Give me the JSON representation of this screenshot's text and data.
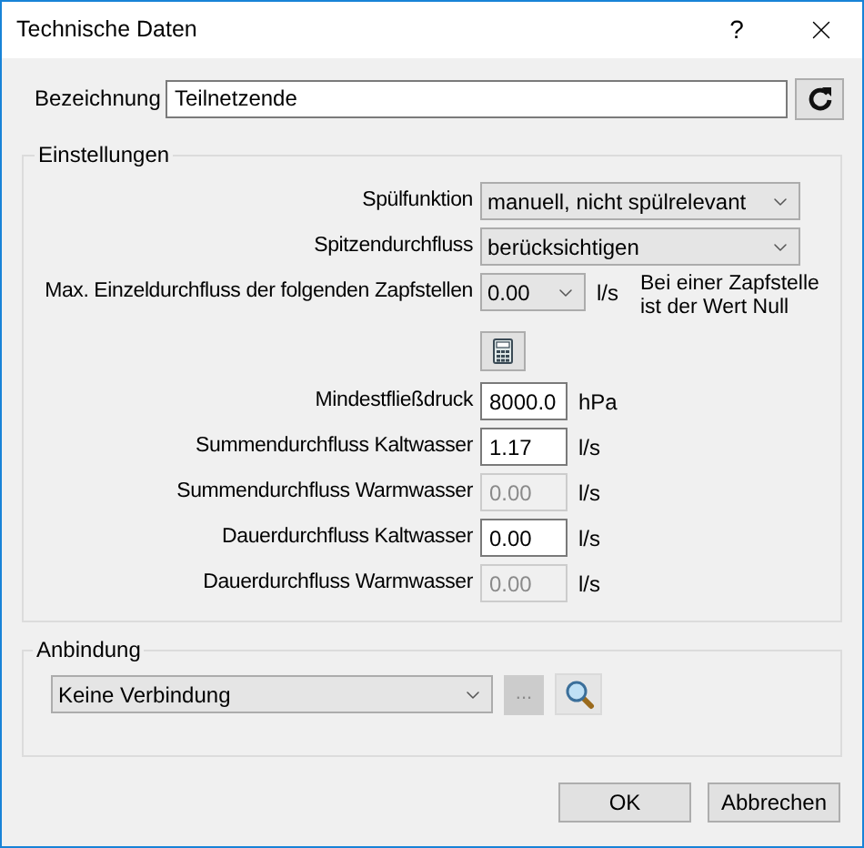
{
  "window": {
    "title": "Technische Daten",
    "help": "?"
  },
  "name_row": {
    "label": "Bezeichnung",
    "value": "Teilnetzende"
  },
  "settings": {
    "title": "Einstellungen",
    "rows": [
      {
        "kind": "select",
        "label": "Spülfunktion",
        "value": "manuell, nicht spülrelevant"
      },
      {
        "kind": "select",
        "label": "Spitzendurchfluss",
        "value": "berücksichtigen"
      },
      {
        "kind": "select",
        "label": "Max. Einzeldurchfluss der folgenden Zapfstellen",
        "value": "0.00",
        "unit": "l/s",
        "note": "Bei einer Zapfstelle ist der Wert Null"
      },
      {
        "kind": "calculator"
      },
      {
        "kind": "number",
        "label": "Mindestfließdruck",
        "value": "8000.0",
        "unit": "hPa",
        "disabled": false
      },
      {
        "kind": "number",
        "label": "Summendurchfluss Kaltwasser",
        "value": "1.17",
        "unit": "l/s",
        "disabled": false
      },
      {
        "kind": "number",
        "label": "Summendurchfluss Warmwasser",
        "value": "0.00",
        "unit": "l/s",
        "disabled": true
      },
      {
        "kind": "number",
        "label": "Dauerdurchfluss Kaltwasser",
        "value": "0.00",
        "unit": "l/s",
        "disabled": false
      },
      {
        "kind": "number",
        "label": "Dauerdurchfluss Warmwasser",
        "value": "0.00",
        "unit": "l/s",
        "disabled": true
      }
    ]
  },
  "connection": {
    "title": "Anbindung",
    "value": "Keine Verbindung",
    "more": {
      "label": "...",
      "disabled": true
    }
  },
  "buttons": [
    {
      "label": "OK"
    },
    {
      "label": "Abbrechen"
    }
  ]
}
